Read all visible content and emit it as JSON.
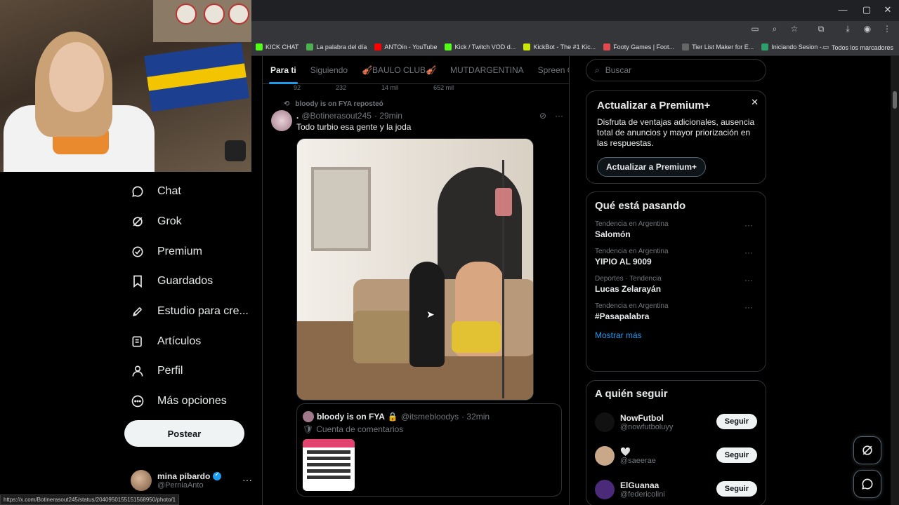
{
  "browser": {
    "window_controls": [
      "—",
      "▢",
      "✕"
    ],
    "bookmarks": [
      {
        "label": "KICK CHAT",
        "color": "#53fc18"
      },
      {
        "label": "La palabra del día",
        "color": "#4caf50"
      },
      {
        "label": "ANTOin - YouTube",
        "color": "#ff0000"
      },
      {
        "label": "Kick / Twitch VOD d...",
        "color": "#53fc18"
      },
      {
        "label": "KickBot - The #1 Kic...",
        "color": "#c8e600"
      },
      {
        "label": "Footy Games | Foot...",
        "color": "#e04a4a"
      },
      {
        "label": "Tier List Maker for E...",
        "color": "#666666"
      },
      {
        "label": "Iniciando Sesion -...",
        "color": "#2e9e6a"
      }
    ],
    "all_bookmarks": "Todos los marcadores",
    "status_url": "https://x.com/Botinerasout245/status/2040950155151568950/photo/1"
  },
  "nav": {
    "items": [
      {
        "label": "Chat",
        "icon": "chat-icon"
      },
      {
        "label": "Grok",
        "icon": "grok-icon"
      },
      {
        "label": "Premium",
        "icon": "premium-icon"
      },
      {
        "label": "Guardados",
        "icon": "bookmark-icon"
      },
      {
        "label": "Estudio para cre...",
        "icon": "rocket-icon"
      },
      {
        "label": "Artículos",
        "icon": "article-icon"
      },
      {
        "label": "Perfil",
        "icon": "profile-icon"
      },
      {
        "label": "Más opciones",
        "icon": "more-icon"
      }
    ],
    "post_button": "Postear",
    "profile": {
      "name": "mina pibardo",
      "handle": "@PerniaAnto",
      "more": "···"
    }
  },
  "timeline": {
    "tabs": [
      "Para ti",
      "Siguiendo",
      "🎻BAULO CLUB🎻",
      "MUTDARGENTINA",
      "Spreen Cla"
    ],
    "prev_actions": [
      "92",
      "232",
      "14 mil",
      "652 mil"
    ],
    "tweet": {
      "repost_note": "bloody is on FYA reposteó",
      "name": ".",
      "handle": "@Botinerasout245",
      "time": "· 29min",
      "text": "Todo turbio esa gente y la joda",
      "more": "···"
    },
    "quote": {
      "name": "bloody is on FYA",
      "lock": "🔒",
      "handle": "@itsmebloodys",
      "time": "· 32min",
      "subtitle": "Cuenta de comentarios"
    }
  },
  "sidebar_right": {
    "search_placeholder": "Buscar",
    "premium": {
      "title": "Actualizar a Premium+",
      "body": "Disfruta de ventajas adicionales, ausencia total de anuncios y mayor priorización en las respuestas.",
      "button": "Actualizar a Premium+",
      "close": "✕"
    },
    "trends": {
      "title": "Qué está pasando",
      "items": [
        {
          "context": "Tendencia en Argentina",
          "name": "Salomón"
        },
        {
          "context": "Tendencia en Argentina",
          "name": "YIPIO AL 9009"
        },
        {
          "context": "Deportes · Tendencia",
          "name": "Lucas Zelarayán"
        },
        {
          "context": "Tendencia en Argentina",
          "name": "#Pasapalabra"
        }
      ],
      "more_dots": "···",
      "show_more": "Mostrar más"
    },
    "follow": {
      "title": "A quién seguir",
      "button": "Seguir",
      "items": [
        {
          "name": "NowFutbol",
          "handle": "@nowfutboluyy",
          "color": "#111111"
        },
        {
          "name": "🤍",
          "handle": "@saeerae",
          "color": "#c9a88a"
        },
        {
          "name": "ElGuanaa",
          "handle": "@federicolini",
          "color": "#4b2a7a"
        }
      ]
    }
  }
}
